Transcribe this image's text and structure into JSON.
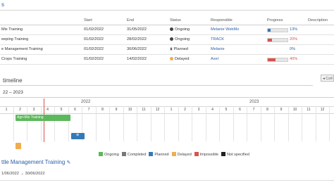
{
  "section": {
    "title": "s"
  },
  "table": {
    "headers": [
      "Start",
      "End",
      "Status",
      "Responsible",
      "Progress",
      "Description"
    ],
    "rows": [
      {
        "name": "Mix Training",
        "start": "01/02/2022",
        "end": "31/05/2022",
        "status": "Ongoing",
        "responsible": "Melanie WebMo",
        "progress": 13,
        "progress_label": "13%",
        "bar_color": "#337ab7"
      },
      {
        "name": "eeping Training",
        "start": "01/02/2022",
        "end": "28/02/2022",
        "status": "Ongoing",
        "responsible": "TRACK",
        "progress": 20,
        "progress_label": "20%",
        "bar_color": "#d9534f"
      },
      {
        "name": "e Management Training",
        "start": "01/02/2022",
        "end": "30/06/2022",
        "status": "Planned",
        "responsible": "Melanie",
        "progress": 0,
        "progress_label": "0%",
        "bar_color": "#337ab7"
      },
      {
        "name": "Crops Training",
        "start": "01/02/2022",
        "end": "14/02/2022",
        "status": "Delayed",
        "responsible": "Axel",
        "progress": 40,
        "progress_label": "40%",
        "bar_color": "#d9534f"
      }
    ]
  },
  "timeline": {
    "title": "timeline",
    "collapse_label": "Coll",
    "year_range": "22 – 2023",
    "years": [
      "2022",
      "2023"
    ],
    "months": [
      "1",
      "2",
      "3",
      "4",
      "5",
      "6",
      "7",
      "8",
      "9",
      "10",
      "11",
      "12",
      "1",
      "2",
      "3",
      "4",
      "5",
      "6",
      "7",
      "8",
      "9",
      "10",
      "11",
      "12",
      "1"
    ],
    "bars": [
      {
        "label": "Agri-Mix Training",
        "color": "#5cb85c"
      },
      {
        "label": "",
        "color": "#337ab7"
      },
      {
        "label": "",
        "color": "#f0ad4e"
      }
    ],
    "legend": [
      {
        "label": "Ongoing",
        "color": "#5cb85c"
      },
      {
        "label": "Completed",
        "color": "#777777"
      },
      {
        "label": "Planned",
        "color": "#337ab7"
      },
      {
        "label": "Delayed",
        "color": "#f0ad4e"
      },
      {
        "label": "Impossible",
        "color": "#d9534f"
      },
      {
        "label": "Not specified",
        "color": "#222222"
      }
    ]
  },
  "project": {
    "title": "ttle Management Training",
    "start": "1/06/2022",
    "arrow": "→",
    "end": "30/06/2022"
  }
}
